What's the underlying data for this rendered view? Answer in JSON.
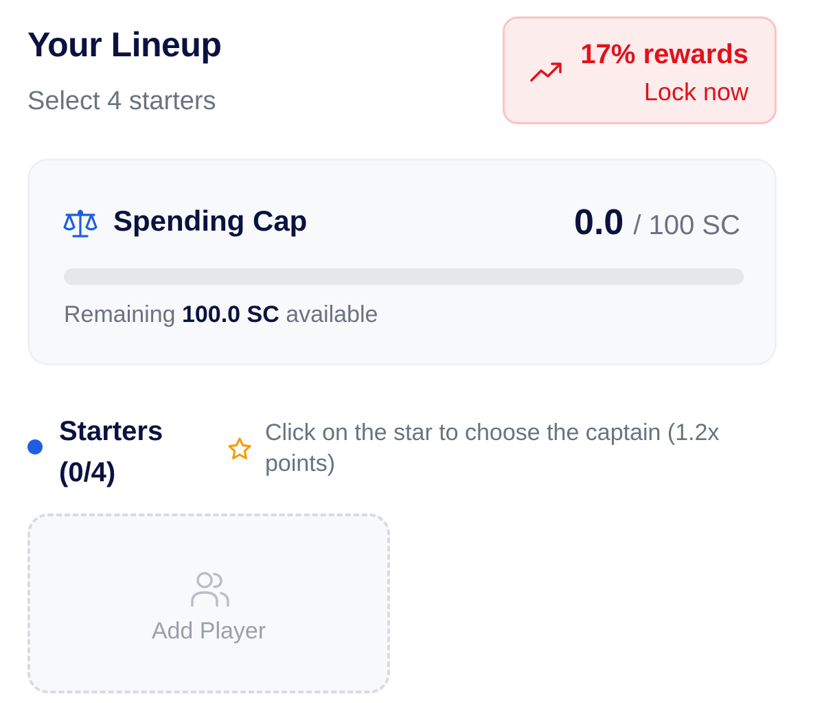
{
  "header": {
    "title": "Your Lineup",
    "subtitle": "Select 4 starters"
  },
  "rewards": {
    "icon": "trending-up-icon",
    "percent_label": "17% rewards",
    "action_label": "Lock now",
    "color": "#e0121c"
  },
  "spending_cap": {
    "icon": "scale-icon",
    "label": "Spending Cap",
    "used": "0.0",
    "total": "/ 100 SC",
    "progress_fraction": 0.0,
    "remaining_prefix": "Remaining",
    "remaining_value": "100.0 SC",
    "remaining_suffix": "available"
  },
  "starters": {
    "label": "Starters (0/4)",
    "hint_icon": "star-icon",
    "hint": "Click on the star to choose the captain (1.2x points)"
  },
  "add_player": {
    "icon": "users-icon",
    "label": "Add Player"
  },
  "colors": {
    "navy": "#0b1240",
    "accent_blue": "#1d5fe0",
    "muted": "#6b7280",
    "star": "#f59e0b"
  }
}
